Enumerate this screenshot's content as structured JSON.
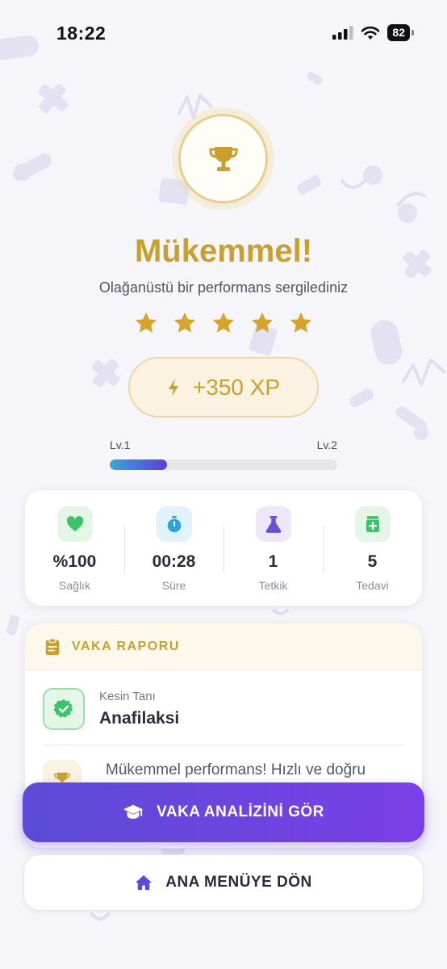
{
  "status_bar": {
    "time": "18:22",
    "battery": "82"
  },
  "result": {
    "title": "Mükemmel!",
    "subtitle": "Olağanüstü bir performans sergilediniz",
    "stars": 5,
    "xp": "+350 XP"
  },
  "level": {
    "current": "Lv.1",
    "next": "Lv.2",
    "progress_fraction": 0.25
  },
  "stats": [
    {
      "icon": "heart-icon",
      "value": "%100",
      "label": "Sağlık",
      "color": "#3cc26a",
      "bg": "#e3f6e8"
    },
    {
      "icon": "stopwatch-icon",
      "value": "00:28",
      "label": "Süre",
      "color": "#2aa3d6",
      "bg": "#e1f2fa"
    },
    {
      "icon": "flask-icon",
      "value": "1",
      "label": "Tetkik",
      "color": "#6a4fd6",
      "bg": "#ece8fa"
    },
    {
      "icon": "medicine-icon",
      "value": "5",
      "label": "Tedavi",
      "color": "#3cc26a",
      "bg": "#e3f6e8"
    }
  ],
  "report": {
    "title": "VAKA RAPORU",
    "diagnosis_label": "Kesin Tanı",
    "diagnosis_value": "Anafilaksi",
    "comment": "Mükemmel performans! Hızlı ve doğru"
  },
  "buttons": {
    "analysis": "VAKA ANALİZİNİ GÖR",
    "menu": "ANA MENÜYE DÖN"
  },
  "colors": {
    "gold": "#c8a02f",
    "primary": "#6a4fe0",
    "success": "#3cc26a"
  }
}
